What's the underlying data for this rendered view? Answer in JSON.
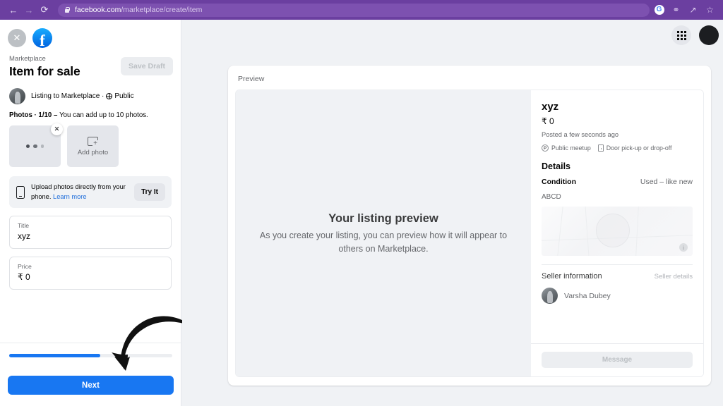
{
  "browser": {
    "back_icon": "back-arrow-icon",
    "forward_icon": "forward-arrow-icon",
    "reload_icon": "reload-icon",
    "url_host": "facebook.com",
    "url_path": "/marketplace/create/item",
    "profile_badge": "G",
    "icons": [
      "google-profile-icon",
      "password-key-icon",
      "share-icon",
      "bookmark-star-icon"
    ]
  },
  "composer": {
    "close_label": "✕",
    "eyebrow": "Marketplace",
    "title": "Item for sale",
    "save_draft_label": "Save Draft",
    "audience_text": "Listing to Marketplace ·",
    "audience_privacy": "Public",
    "photos_count": "Photos · 1/10 – ",
    "photos_hint": "You can add up to 10 photos.",
    "remove_photo_label": "✕",
    "add_photo_label": "Add photo",
    "upload_hint_text": "Upload photos directly from your phone. ",
    "upload_hint_link": "Learn more",
    "try_it_label": "Try It",
    "fields": [
      {
        "label": "Title",
        "value": "xyz"
      },
      {
        "label": "Price",
        "value": "₹ 0"
      }
    ],
    "progress_percent": 56,
    "next_label": "Next"
  },
  "topbar": {
    "menu_icon": "apps-grid-icon",
    "account_icon": "account-avatar-icon"
  },
  "preview": {
    "label": "Preview",
    "empty_title": "Your listing preview",
    "empty_body": "As you create your listing, you can preview how it will appear to others on Marketplace.",
    "listing": {
      "title": "xyz",
      "price": "₹ 0",
      "posted": "Posted a few seconds ago",
      "tags": [
        {
          "icon": "public-meetup-icon",
          "label": "Public meetup"
        },
        {
          "icon": "door-pickup-icon",
          "label": "Door pick-up or drop-off"
        }
      ],
      "details_heading": "Details",
      "detail_key": "Condition",
      "detail_value": "Used – like new",
      "description": "ABCD",
      "map_info_label": "i"
    },
    "seller": {
      "heading": "Seller information",
      "details_link": "Seller details",
      "name": "Varsha Dubey",
      "message_label": "Message"
    }
  },
  "colors": {
    "browser_purple": "#6b3fa0",
    "facebook_blue": "#1877f2",
    "page_bg": "#f0f2f5",
    "link_blue": "#216fdb"
  }
}
